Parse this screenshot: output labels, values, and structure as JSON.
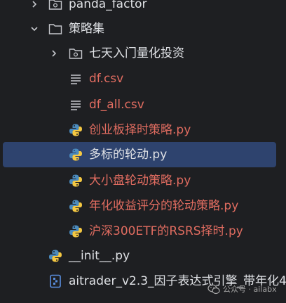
{
  "tree": {
    "rows": [
      {
        "label": "panda_factor",
        "kind": "folder"
      },
      {
        "label": "策略集",
        "kind": "folder-open"
      },
      {
        "label": "七天入门量化投资",
        "kind": "package"
      },
      {
        "label": "df.csv",
        "kind": "text-file"
      },
      {
        "label": "df_all.csv",
        "kind": "text-file"
      },
      {
        "label": "创业板择时策略.py",
        "kind": "python-file"
      },
      {
        "label": "多标的轮动.py",
        "kind": "python-file",
        "selected": true
      },
      {
        "label": "大小盘轮动策略.py",
        "kind": "python-file"
      },
      {
        "label": "年化收益评分的轮动策略.py",
        "kind": "python-file"
      },
      {
        "label": "沪深300ETF的RSRS择时.py",
        "kind": "python-file"
      },
      {
        "label": "__init__.py",
        "kind": "python-file"
      },
      {
        "label": "aitrader_v2.3_因子表达式引擎_带年化4",
        "kind": "notebook-file"
      }
    ]
  },
  "watermark": {
    "text": "公众号 · ailabx"
  },
  "colors": {
    "background": "#1e1f22",
    "selection": "#2e436e",
    "folder_text": "#dfe1e5",
    "modified_file_text": "#e06c60",
    "python_blue": "#4b8bbe",
    "python_yellow": "#f5c842"
  }
}
